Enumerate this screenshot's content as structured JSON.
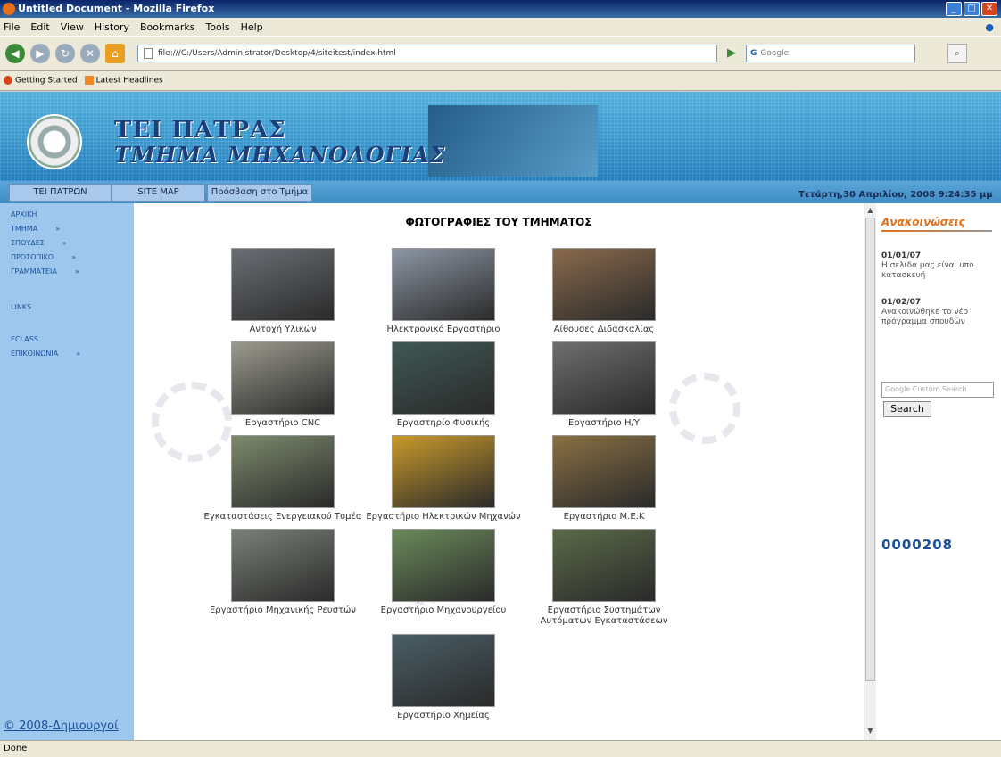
{
  "window": {
    "title": "Untitled Document - Mozilla Firefox",
    "controls": {
      "minimize": "_",
      "maximize": "□",
      "close": "✕"
    }
  },
  "menu": [
    "File",
    "Edit",
    "View",
    "History",
    "Bookmarks",
    "Tools",
    "Help"
  ],
  "toolbar": {
    "url": "file:///C:/Users/Administrator/Desktop/4/siteitest/index.html",
    "search_engine": "G",
    "search_placeholder": "Google"
  },
  "bookmarks": [
    "Getting Started",
    "Latest Headlines"
  ],
  "banner": {
    "title": "ΤΕΙ ΠΑΤΡΑΣ",
    "subtitle": "ΤΜΗΜΑ ΜΗΧΑΝΟΛΟΓΙΑΣ"
  },
  "topnav": {
    "items": [
      "ΤΕΙ ΠΑΤΡΩΝ",
      "SITE MAP",
      "Πρόσβαση στο Τμήμα"
    ],
    "date": "Τετάρτη,30 Απριλίου, 2008 9:24:35 μμ"
  },
  "sidebar": {
    "items": [
      {
        "label": "ΑΡΧΙΚΗ",
        "arrow": ""
      },
      {
        "label": "ΤΜΗΜΑ",
        "arrow": "»"
      },
      {
        "label": "ΣΠΟΥΔΕΣ",
        "arrow": "»"
      },
      {
        "label": "ΠΡΟΣΩΠΙΚΟ",
        "arrow": "»"
      },
      {
        "label": "ΓΡΑΜΜΑΤΕΙΑ",
        "arrow": "»"
      },
      {
        "label": "LINKS",
        "arrow": ""
      },
      {
        "label": "ECLASS",
        "arrow": ""
      },
      {
        "label": "ΕΠΙΚΟΙΝΩΝΙΑ",
        "arrow": "»"
      }
    ],
    "copyright": "© 2008-Δημιουργοί"
  },
  "main": {
    "title": "ΦΩΤΟΓΡΑΦΙΕΣ ΤΟΥ ΤΜΗΜΑΤΟΣ",
    "gallery": [
      {
        "caption": "Αντοχή Υλικών",
        "color": "#6a6e74"
      },
      {
        "caption": "Ηλεκτρονικό Εργαστήριο",
        "color": "#8c96a4"
      },
      {
        "caption": "Αίθουσες Διδασκαλίας",
        "color": "#8a6a4c"
      },
      {
        "caption": "Εργαστήριο CNC",
        "color": "#9a9a8e"
      },
      {
        "caption": "Εργαστηρίο Φυσικής",
        "color": "#3f5854"
      },
      {
        "caption": "Εργαστήριο Η/Υ",
        "color": "#6e6e6e"
      },
      {
        "caption": "Εγκαταστάσεις Ενεργειακού Τομέα",
        "color": "#7c8a6c"
      },
      {
        "caption": "Εργαστήριο Ηλεκτρικών Μηχανών",
        "color": "#c89a2a"
      },
      {
        "caption": "Εργαστήριο Μ.Ε.Κ",
        "color": "#8a7044"
      },
      {
        "caption": "Εργαστήριο Μηχανικής Ρευστών",
        "color": "#7a8078"
      },
      {
        "caption": "Εργαστήριο Μηχανουργείου",
        "color": "#6a8a5a"
      },
      {
        "caption": "Εργαστήριο Συστημάτων Αυτόματων Εγκαταστάσεων",
        "color": "#5a6a48"
      },
      {
        "caption": "Εργαστήριο Χημείας",
        "color": "#4a5e66"
      }
    ]
  },
  "rightpanel": {
    "title": "Ανακοινώσεις",
    "news": [
      {
        "date": "01/01/07",
        "text": "Η σελίδα μας είναι υπο κατασκευή"
      },
      {
        "date": "01/02/07",
        "text": "Ανακοινώθηκε το νέο πρόγραμμα σπουδών"
      }
    ],
    "search_placeholder": "Google Custom Search",
    "search_button": "Search",
    "counter": "0000208",
    "widget": "vooh"
  },
  "status": "Done"
}
